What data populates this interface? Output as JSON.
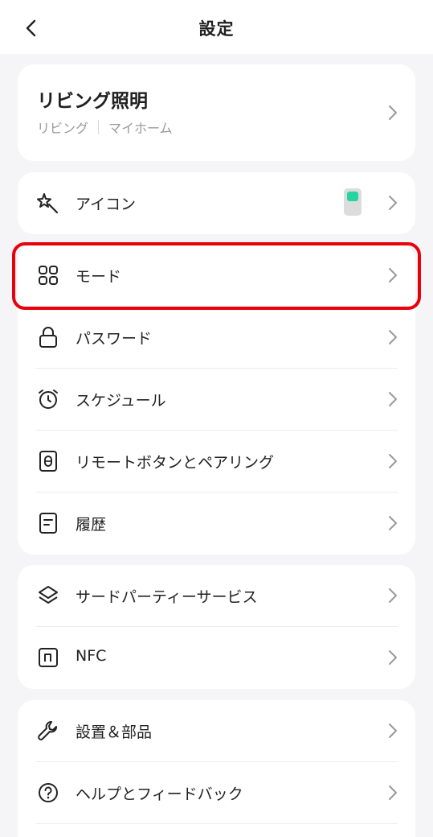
{
  "header": {
    "title": "設定",
    "back_icon": "chevron-left-icon"
  },
  "device": {
    "name": "リビング照明",
    "room": "リビング",
    "home": "マイホーム"
  },
  "group1": [
    {
      "label": "アイコン",
      "icon": "magic-wand-icon",
      "has_thumbnail": true
    }
  ],
  "group2": [
    {
      "label": "モード",
      "icon": "grid-icon",
      "highlighted": true
    },
    {
      "label": "パスワード",
      "icon": "lock-icon"
    },
    {
      "label": "スケジュール",
      "icon": "alarm-clock-icon"
    },
    {
      "label": "リモートボタンとペアリング",
      "icon": "remote-icon"
    },
    {
      "label": "履歴",
      "icon": "document-icon"
    }
  ],
  "group3": [
    {
      "label": "サードパーティーサービス",
      "icon": "layers-icon"
    },
    {
      "label": "NFC",
      "icon": "nfc-icon"
    }
  ],
  "group4": [
    {
      "label": "設置＆部品",
      "icon": "wrench-icon"
    },
    {
      "label": "ヘルプとフィードバック",
      "icon": "help-icon"
    }
  ],
  "colors": {
    "highlight": "#e8000b",
    "thumbnail_led": "#27d4a0",
    "background": "#f5f5f7"
  }
}
